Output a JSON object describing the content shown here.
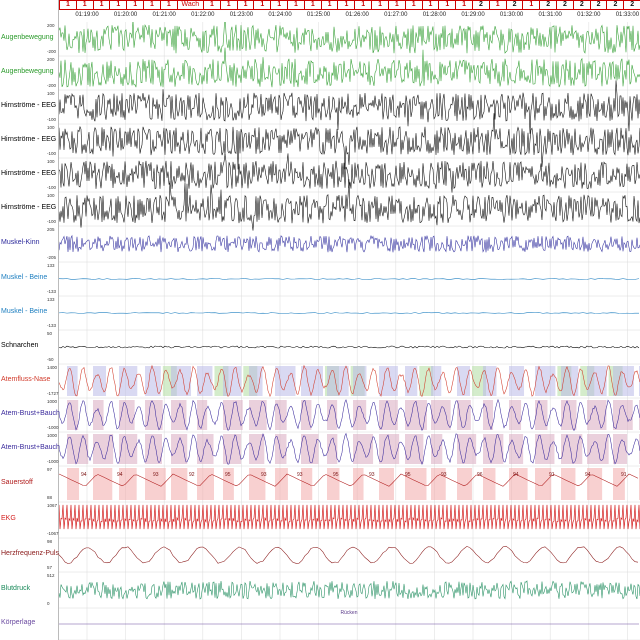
{
  "stages": [
    "1",
    "1",
    "1",
    "1",
    "1",
    "1",
    "1",
    "Wach",
    "1",
    "1",
    "1",
    "1",
    "1",
    "1",
    "1",
    "1",
    "1",
    "1",
    "1",
    "1",
    "1",
    "1",
    "1",
    "1",
    "2",
    "1",
    "2",
    "1",
    "2",
    "2",
    "2",
    "2",
    "2",
    "2"
  ],
  "times": [
    "01:19:00",
    "01:20:00",
    "01:21:00",
    "01:22:00",
    "01:23:00",
    "01:24:00",
    "01:25:00",
    "01:26:00",
    "01:27:00",
    "01:28:00",
    "01:29:00",
    "01:30:00",
    "01:31:00",
    "01:32:00",
    "01:33:00"
  ],
  "channels": [
    {
      "label": "Augenbewegung",
      "color": "#2a9a2a",
      "top": "200",
      "bottom": "-200"
    },
    {
      "label": "Augenbewegung",
      "color": "#2a9a2a",
      "top": "200",
      "bottom": "-200"
    },
    {
      "label": "Hirnströme - EEG",
      "color": "#000000",
      "top": "100",
      "bottom": "-100"
    },
    {
      "label": "Hirnströme - EEG",
      "color": "#000000",
      "top": "100",
      "bottom": "-100"
    },
    {
      "label": "Hirnströme - EEG",
      "color": "#000000",
      "top": "100",
      "bottom": "-100"
    },
    {
      "label": "Hirnströme - EEG",
      "color": "#000000",
      "top": "100",
      "bottom": "-100"
    },
    {
      "label": "Muskel-Kinn",
      "color": "#2c2a9c",
      "top": "205",
      "bottom": "-205"
    },
    {
      "label": "Muskel - Beine",
      "color": "#1e7fc0",
      "top": "133",
      "bottom": "-133"
    },
    {
      "label": "Muskel - Beine",
      "color": "#1e7fc0",
      "top": "133",
      "bottom": "-133"
    },
    {
      "label": "Schnarchen",
      "color": "#000000",
      "top": "50",
      "bottom": "-50"
    },
    {
      "label": "Atemfluss-Nase",
      "color": "#d13a2a",
      "top": "1400",
      "bottom": "-1727"
    },
    {
      "label": "Atem-Brust+Bauch",
      "color": "#3a2a9c",
      "top": "1000",
      "bottom": "-1000"
    },
    {
      "label": "Atem-Brust+Bauch",
      "color": "#3a2a9c",
      "top": "1000",
      "bottom": "-1000"
    },
    {
      "label": "Sauerstoff",
      "color": "#b01c1c",
      "top": "97",
      "bottom": "88"
    },
    {
      "label": "EKG",
      "color": "#d42020",
      "top": "1067",
      "bottom": "-1067"
    },
    {
      "label": "Herzfrequenz-Puls",
      "color": "#8a1a1a",
      "top": "98",
      "bottom": "57"
    },
    {
      "label": "Blutdruck",
      "color": "#1a8a5a",
      "top": "512",
      "bottom": "0"
    },
    {
      "label": "Körperlage",
      "color": "#6a4aa0",
      "top": "",
      "bottom": ""
    }
  ],
  "bodyposition": "Rücken",
  "spo2_values": [
    "94",
    "94",
    "93",
    "92",
    "95",
    "93",
    "93",
    "95",
    "93",
    "95",
    "93",
    "96",
    "94",
    "91",
    "94",
    "91"
  ]
}
